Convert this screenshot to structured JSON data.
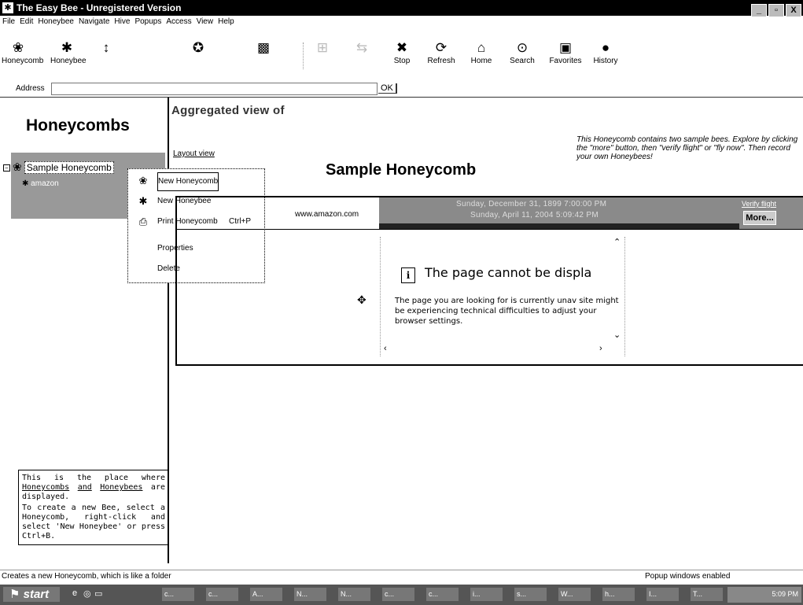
{
  "window": {
    "title": "The Easy Bee - Unregistered Version",
    "buttons": [
      "_",
      "▫",
      "X"
    ]
  },
  "menu": [
    "File",
    "Edit",
    "Honeybee",
    "Navigate",
    "Hive",
    "Popups",
    "Access",
    "View",
    "Help"
  ],
  "toolbar": {
    "honeycomb": "Honeycomb",
    "honeybee": "Honeybee",
    "stop": "Stop",
    "refresh": "Refresh",
    "home": "Home",
    "search": "Search",
    "favorites": "Favorites",
    "history": "History"
  },
  "address": {
    "label": "Address",
    "value": "",
    "ok": "OK"
  },
  "left": {
    "title": "Honeycombs",
    "tree": {
      "honeycomb": "Sample Honeycomb",
      "bee": "amazon"
    },
    "info_part1": "This is the place where",
    "info_link1": "Honeycombs",
    "info_and": "and",
    "info_link2": "Honeybees",
    "info_part2": "are displayed.",
    "info_part3": "To create a new Bee, select a Honeycomb, right-click and select 'New Honeybee' or press Ctrl+B."
  },
  "context_menu": {
    "new_honeycomb": "New Honeycomb",
    "new_honeybee": "New Honeybee",
    "print": "Print Honeycomb",
    "print_shortcut": "Ctrl+P",
    "properties": "Properties",
    "delete": "Delete"
  },
  "main": {
    "title": "Aggregated view of",
    "layout_link": "Layout view",
    "honeycomb_name": "Sample Honeycomb",
    "description": "This Honeycomb contains two sample bees. Explore by clicking the \"more\" button, then \"verify flight\" or \"fly now\". Then record your own Honeybees!",
    "bee_url": "www.amazon.com",
    "date1": "Sunday, December 31, 1899 7:00:00 PM",
    "date2": "Sunday, April 11, 2004 5:09:42 PM",
    "verify": "Verify flight",
    "more": "More...",
    "error_title": "The page cannot be displa",
    "error_body": "The page you are looking for is currently unav site might be experiencing technical difficulties to adjust your browser settings."
  },
  "status": {
    "left": "Creates a new Honeycomb, which is like a folder",
    "right": "Popup windows enabled"
  },
  "taskbar": {
    "start": "start",
    "tasks": [
      "c...",
      "c...",
      "A...",
      "N...",
      "N...",
      "c...",
      "c...",
      "i...",
      "s...",
      "W...",
      "h...",
      "I...",
      "T..."
    ],
    "time": "5:09 PM"
  }
}
